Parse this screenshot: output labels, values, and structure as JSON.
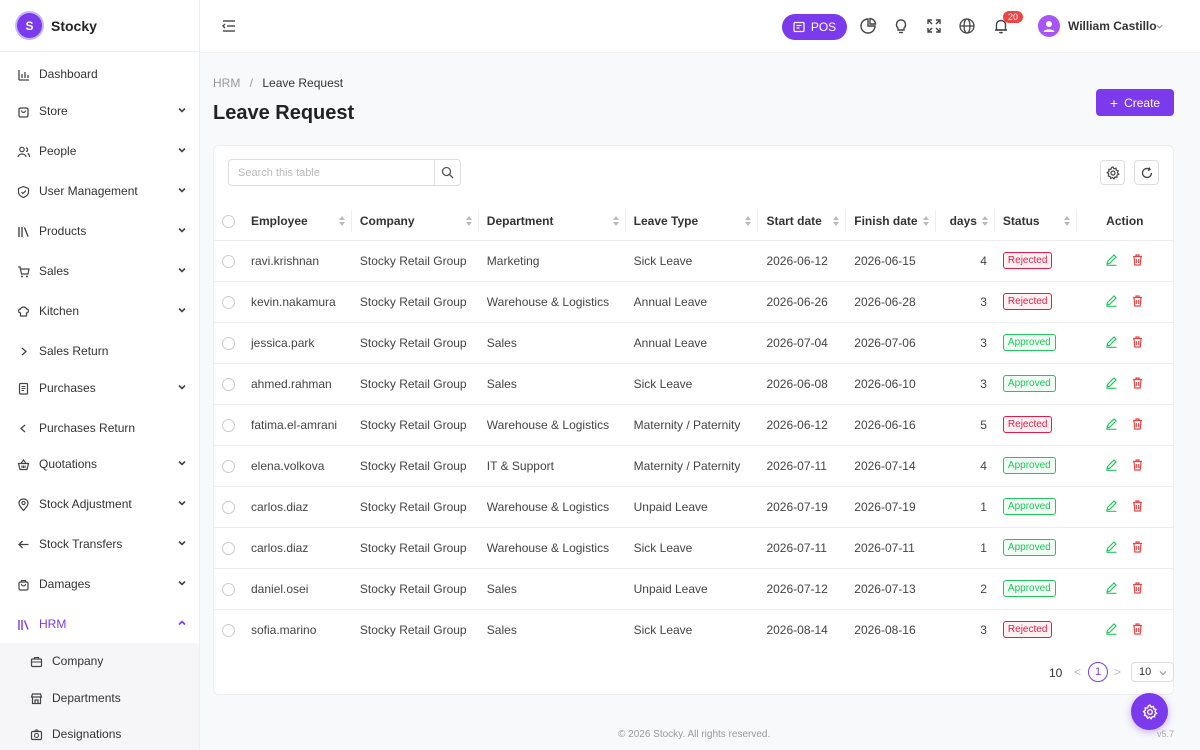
{
  "app": {
    "logo_letter": "S",
    "name": "Stocky"
  },
  "sidebar": {
    "items": [
      {
        "label": "Dashboard",
        "icon": "bar-chart-icon"
      },
      {
        "label": "Store",
        "icon": "store-icon"
      },
      {
        "label": "People",
        "icon": "people-icon"
      },
      {
        "label": "User Management",
        "icon": "shield-icon"
      },
      {
        "label": "Products",
        "icon": "library-icon"
      },
      {
        "label": "Sales",
        "icon": "cart-icon"
      },
      {
        "label": "Kitchen",
        "icon": "chef-hat-icon"
      },
      {
        "label": "Sales Return",
        "icon": "chevron-right-icon"
      },
      {
        "label": "Purchases",
        "icon": "receipt-icon"
      },
      {
        "label": "Purchases Return",
        "icon": "chevron-left-icon"
      },
      {
        "label": "Quotations",
        "icon": "basket-icon"
      },
      {
        "label": "Stock Adjustment",
        "icon": "location-pin-icon"
      },
      {
        "label": "Stock Transfers",
        "icon": "arrow-left-icon"
      },
      {
        "label": "Damages",
        "icon": "bag-icon"
      },
      {
        "label": "HRM",
        "icon": "library-icon"
      }
    ],
    "hrm_sub": [
      {
        "label": "Company",
        "icon": "briefcase-icon"
      },
      {
        "label": "Departments",
        "icon": "building-icon"
      },
      {
        "label": "Designations",
        "icon": "camera-icon"
      }
    ]
  },
  "topbar": {
    "pos_label": "POS",
    "notification_count": "20",
    "user_name": "William Castillo"
  },
  "breadcrumb": {
    "parent": "HRM",
    "separator": "/",
    "current": "Leave Request"
  },
  "page": {
    "title": "Leave Request",
    "create_label": "Create"
  },
  "table": {
    "search_placeholder": "Search this table",
    "columns": [
      "Employee",
      "Company",
      "Department",
      "Leave Type",
      "Start date",
      "Finish date",
      "days",
      "Status",
      "Action"
    ],
    "rows": [
      {
        "employee": "ravi.krishnan",
        "company": "Stocky Retail Group",
        "department": "Marketing",
        "leave_type": "Sick Leave",
        "start": "2026-06-12",
        "finish": "2026-06-15",
        "days": "4",
        "status": "Rejected"
      },
      {
        "employee": "kevin.nakamura",
        "company": "Stocky Retail Group",
        "department": "Warehouse & Logistics",
        "leave_type": "Annual Leave",
        "start": "2026-06-26",
        "finish": "2026-06-28",
        "days": "3",
        "status": "Rejected"
      },
      {
        "employee": "jessica.park",
        "company": "Stocky Retail Group",
        "department": "Sales",
        "leave_type": "Annual Leave",
        "start": "2026-07-04",
        "finish": "2026-07-06",
        "days": "3",
        "status": "Approved"
      },
      {
        "employee": "ahmed.rahman",
        "company": "Stocky Retail Group",
        "department": "Sales",
        "leave_type": "Sick Leave",
        "start": "2026-06-08",
        "finish": "2026-06-10",
        "days": "3",
        "status": "Approved"
      },
      {
        "employee": "fatima.el-amrani",
        "company": "Stocky Retail Group",
        "department": "Warehouse & Logistics",
        "leave_type": "Maternity / Paternity",
        "start": "2026-06-12",
        "finish": "2026-06-16",
        "days": "5",
        "status": "Rejected"
      },
      {
        "employee": "elena.volkova",
        "company": "Stocky Retail Group",
        "department": "IT & Support",
        "leave_type": "Maternity / Paternity",
        "start": "2026-07-11",
        "finish": "2026-07-14",
        "days": "4",
        "status": "Approved"
      },
      {
        "employee": "carlos.diaz",
        "company": "Stocky Retail Group",
        "department": "Warehouse & Logistics",
        "leave_type": "Unpaid Leave",
        "start": "2026-07-19",
        "finish": "2026-07-19",
        "days": "1",
        "status": "Approved"
      },
      {
        "employee": "carlos.diaz",
        "company": "Stocky Retail Group",
        "department": "Warehouse & Logistics",
        "leave_type": "Sick Leave",
        "start": "2026-07-11",
        "finish": "2026-07-11",
        "days": "1",
        "status": "Approved"
      },
      {
        "employee": "daniel.osei",
        "company": "Stocky Retail Group",
        "department": "Sales",
        "leave_type": "Unpaid Leave",
        "start": "2026-07-12",
        "finish": "2026-07-13",
        "days": "2",
        "status": "Approved"
      },
      {
        "employee": "sofia.marino",
        "company": "Stocky Retail Group",
        "department": "Sales",
        "leave_type": "Sick Leave",
        "start": "2026-08-14",
        "finish": "2026-08-16",
        "days": "3",
        "status": "Rejected"
      }
    ]
  },
  "pagination": {
    "total": "10",
    "prev": "<",
    "current_page": "1",
    "next": ">",
    "page_size": "10"
  },
  "footer": {
    "copyright": "© 2026 Stocky. All rights reserved.",
    "version": "v5.7"
  },
  "colors": {
    "accent": "#7c3aed",
    "danger": "#e11d48",
    "success": "#22c55e"
  }
}
